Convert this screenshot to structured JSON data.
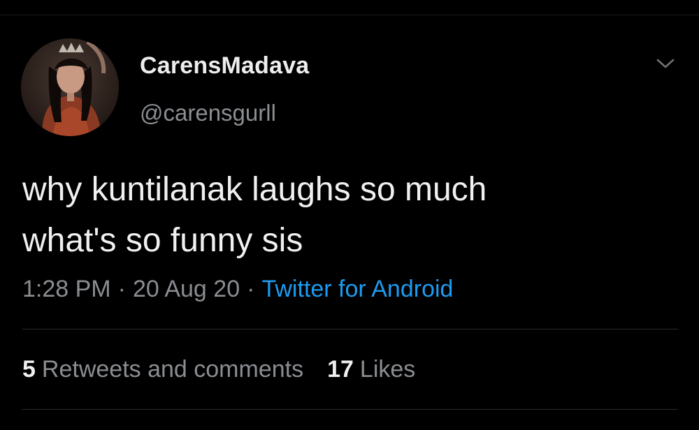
{
  "user": {
    "display_name": "CarensMadava",
    "handle": "@carensgurll"
  },
  "tweet": {
    "text_lines": [
      "why kuntilanak laughs so much",
      "what's so funny sis"
    ],
    "time": "1:28 PM",
    "date": "20 Aug 20",
    "separator": "·",
    "source": "Twitter for Android"
  },
  "stats": {
    "retweets_count": "5",
    "retweets_label": "Retweets and comments",
    "likes_count": "17",
    "likes_label": "Likes"
  },
  "icons": {
    "more": "chevron-down-icon"
  },
  "colors": {
    "background": "#000000",
    "text": "#f0f0f0",
    "secondary": "#8a8d91",
    "link": "#1d9bf0",
    "divider": "#2a2a2a"
  }
}
